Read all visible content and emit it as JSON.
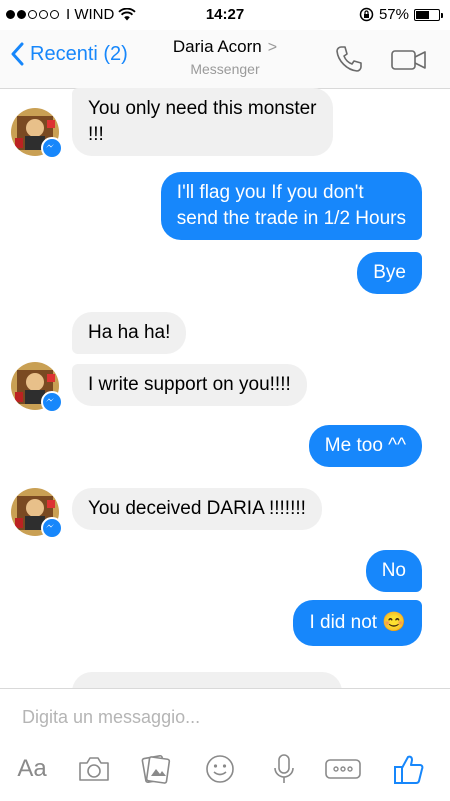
{
  "status_bar": {
    "carrier": "I WIND",
    "time": "14:27",
    "battery": "57%",
    "battery_level": 0.57
  },
  "header": {
    "back_label": "Recenti (2)",
    "contact_name": "Daria Acorn",
    "subtitle": "Messenger"
  },
  "messages": [
    {
      "from": "them",
      "lines": [
        "You only need this monster",
        "!!!"
      ]
    },
    {
      "from": "me",
      "lines": [
        "I'll flag you If you don't",
        "send the trade in 1/2 Hours"
      ]
    },
    {
      "from": "me",
      "lines": [
        "Bye"
      ]
    },
    {
      "from": "them",
      "lines": [
        "Ha ha ha!"
      ]
    },
    {
      "from": "them",
      "lines": [
        "I write support on you!!!!"
      ]
    },
    {
      "from": "me",
      "lines": [
        "Me too ^^"
      ]
    },
    {
      "from": "them",
      "lines": [
        "You deceived DARIA !!!!!!!"
      ]
    },
    {
      "from": "me",
      "lines": [
        "No"
      ]
    },
    {
      "from": "me",
      "lines": [
        "I did not 😊"
      ]
    }
  ],
  "composer": {
    "placeholder": "Digita un messaggio...",
    "text_tool": "Aa"
  },
  "colors": {
    "accent": "#1787fb",
    "incoming_bubble": "#f0f0f0"
  }
}
